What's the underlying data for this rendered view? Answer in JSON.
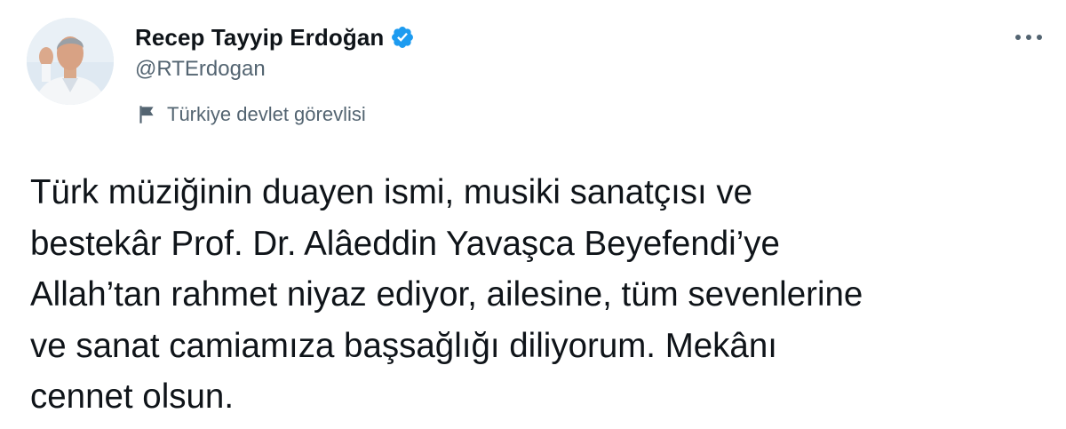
{
  "tweet": {
    "author": {
      "display_name": "Recep Tayyip Erdoğan",
      "handle": "@RTErdogan",
      "verified": true,
      "avatar_icon": "profile-photo",
      "label_icon": "flag-icon",
      "label_text": "Türkiye devlet görevlisi"
    },
    "more_icon": "more-horizontal-icon",
    "text": "Türk müziğinin duayen ismi, musiki sanatçısı ve\nbestekâr Prof. Dr. Alâeddin Yavaşca Beyefendi’ye\nAllah’tan rahmet niyaz ediyor, ailesine, tüm sevenlerine\nve sanat camiamıza başsağlığı diliyorum. Mekânı\ncennet olsun."
  },
  "colors": {
    "text_primary": "#0f1419",
    "text_secondary": "#536471",
    "verified_blue": "#1d9bf0",
    "background": "#ffffff"
  }
}
